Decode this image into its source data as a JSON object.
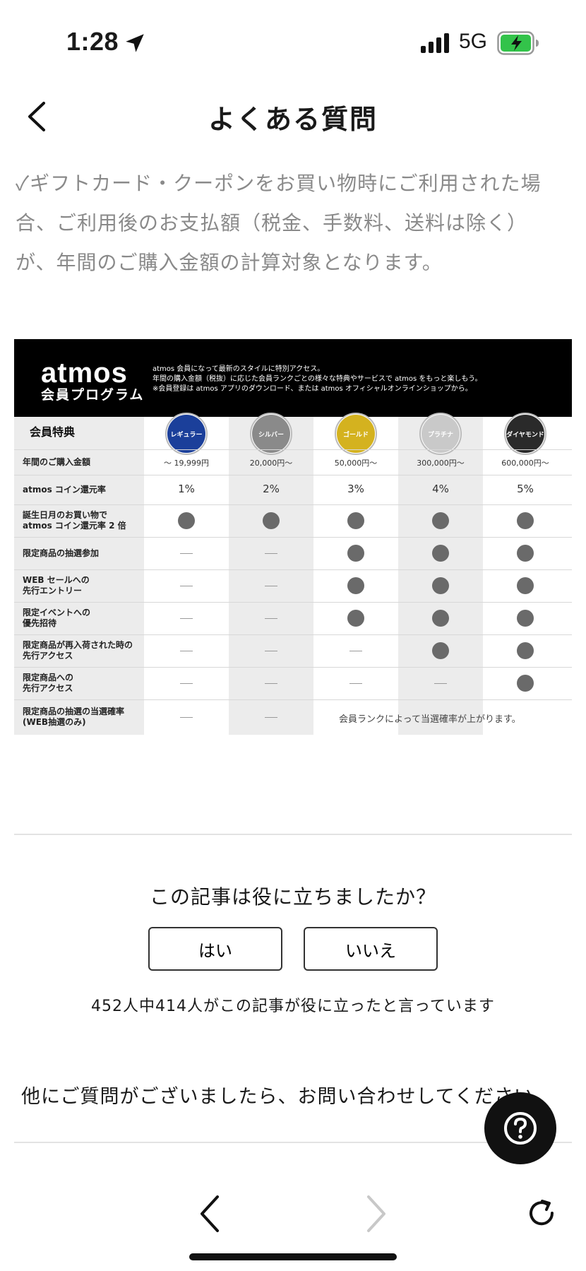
{
  "status_bar": {
    "time": "1:28",
    "network": "5G"
  },
  "nav": {
    "title": "よくある質問"
  },
  "intro": {
    "lines": [
      "✓ギフトカード・クーポンをお買い物時にご利用された場",
      "合、ご利用後のお支払額（税金、手数料、送料は除く）",
      "が、年間のご購入金額の計算対象となります。"
    ]
  },
  "program": {
    "logo": "atmos",
    "subtitle": "会員プログラム",
    "description": [
      "atmos 会員になって最新のスタイルに特別アクセス。",
      "年間の購入金額（税抜）に応じた会員ランクごとの様々な特典やサービスで atmos をもっと楽しもう。",
      "※会員登録は atmos アプリのダウンロード、または atmos オフィシャルオンラインショップから。"
    ],
    "benefits_label": "会員特典",
    "tiers": [
      {
        "name": "レギュラー",
        "price": "〜 19,999円",
        "rate": "1%",
        "color": "#1b3f9a"
      },
      {
        "name": "シルバー",
        "price": "20,000円〜",
        "rate": "2%",
        "color": "#8a8a8a"
      },
      {
        "name": "ゴールド",
        "price": "50,000円〜",
        "rate": "3%",
        "color": "#d4b21f"
      },
      {
        "name": "プラチナ",
        "price": "300,000円〜",
        "rate": "4%",
        "color": "#c9c9c9"
      },
      {
        "name": "ダイヤモンド",
        "price": "600,000円〜",
        "rate": "5%",
        "color": "#2a2a2a"
      }
    ],
    "rows": [
      {
        "label": "年間のご購入金額"
      },
      {
        "label": "atmos コイン還元率"
      },
      {
        "label": "誕生日月のお買い物で\natmos コイン還元率 2 倍",
        "marks": [
          1,
          1,
          1,
          1,
          1
        ]
      },
      {
        "label": "限定商品の抽選参加",
        "marks": [
          0,
          0,
          1,
          1,
          1
        ]
      },
      {
        "label": "WEB セールへの\n先行エントリー",
        "marks": [
          0,
          0,
          1,
          1,
          1
        ]
      },
      {
        "label": "限定イベントへの\n優先招待",
        "marks": [
          0,
          0,
          1,
          1,
          1
        ]
      },
      {
        "label": "限定商品が再入荷された時の\n先行アクセス",
        "marks": [
          0,
          0,
          0,
          1,
          1
        ]
      },
      {
        "label": "限定商品への\n先行アクセス",
        "marks": [
          0,
          0,
          0,
          0,
          1
        ]
      },
      {
        "label": "限定商品の抽選の当選確率\n(WEB抽選のみ)",
        "marks": [
          0,
          0
        ],
        "note": "会員ランクによって当選確率が上がります。"
      }
    ]
  },
  "feedback": {
    "question": "この記事は役に立ちましたか？",
    "yes_label": "はい",
    "no_label": "いいえ",
    "count_text": "452人中414人がこの記事が役に立ったと言っています"
  },
  "contact": {
    "text": "他にご質問がございましたら、お問い合わせしてください"
  },
  "icons": {
    "back": "chevron-left-icon",
    "help": "question-circle-icon",
    "browser_back": "chevron-left-icon",
    "browser_forward": "chevron-right-icon",
    "reload": "reload-icon"
  }
}
